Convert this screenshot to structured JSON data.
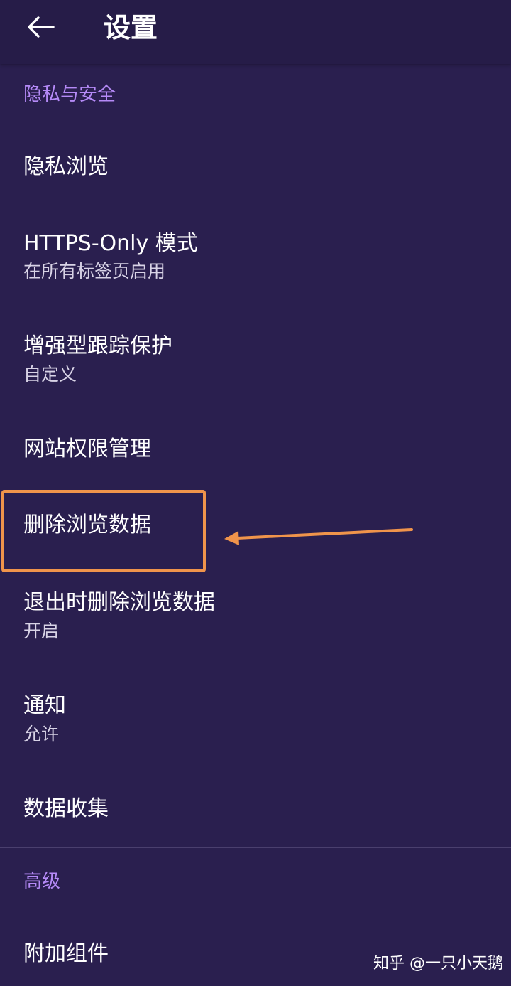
{
  "header": {
    "title": "设置",
    "back_icon": "arrow-left-icon"
  },
  "sections": {
    "privacy": {
      "label": "隐私与安全"
    },
    "advanced": {
      "label": "高级"
    }
  },
  "items": {
    "private_browsing": {
      "title": "隐私浏览"
    },
    "https_only": {
      "title": "HTTPS-Only 模式",
      "subtitle": "在所有标签页启用"
    },
    "tracking_protection": {
      "title": "增强型跟踪保护",
      "subtitle": "自定义"
    },
    "site_permissions": {
      "title": "网站权限管理"
    },
    "delete_browsing_data": {
      "title": "删除浏览数据"
    },
    "delete_on_quit": {
      "title": "退出时删除浏览数据",
      "subtitle": "开启"
    },
    "notifications": {
      "title": "通知",
      "subtitle": "允许"
    },
    "data_collection": {
      "title": "数据收集"
    },
    "addons": {
      "title": "附加组件"
    }
  },
  "annotation": {
    "highlight_color": "#f0944b"
  },
  "watermark": {
    "text": "知乎 @一只小天鹅"
  },
  "colors": {
    "background": "#2a1f4f",
    "accent": "#b58af7",
    "text": "#ffffff",
    "subtext": "#d8d3e6"
  }
}
